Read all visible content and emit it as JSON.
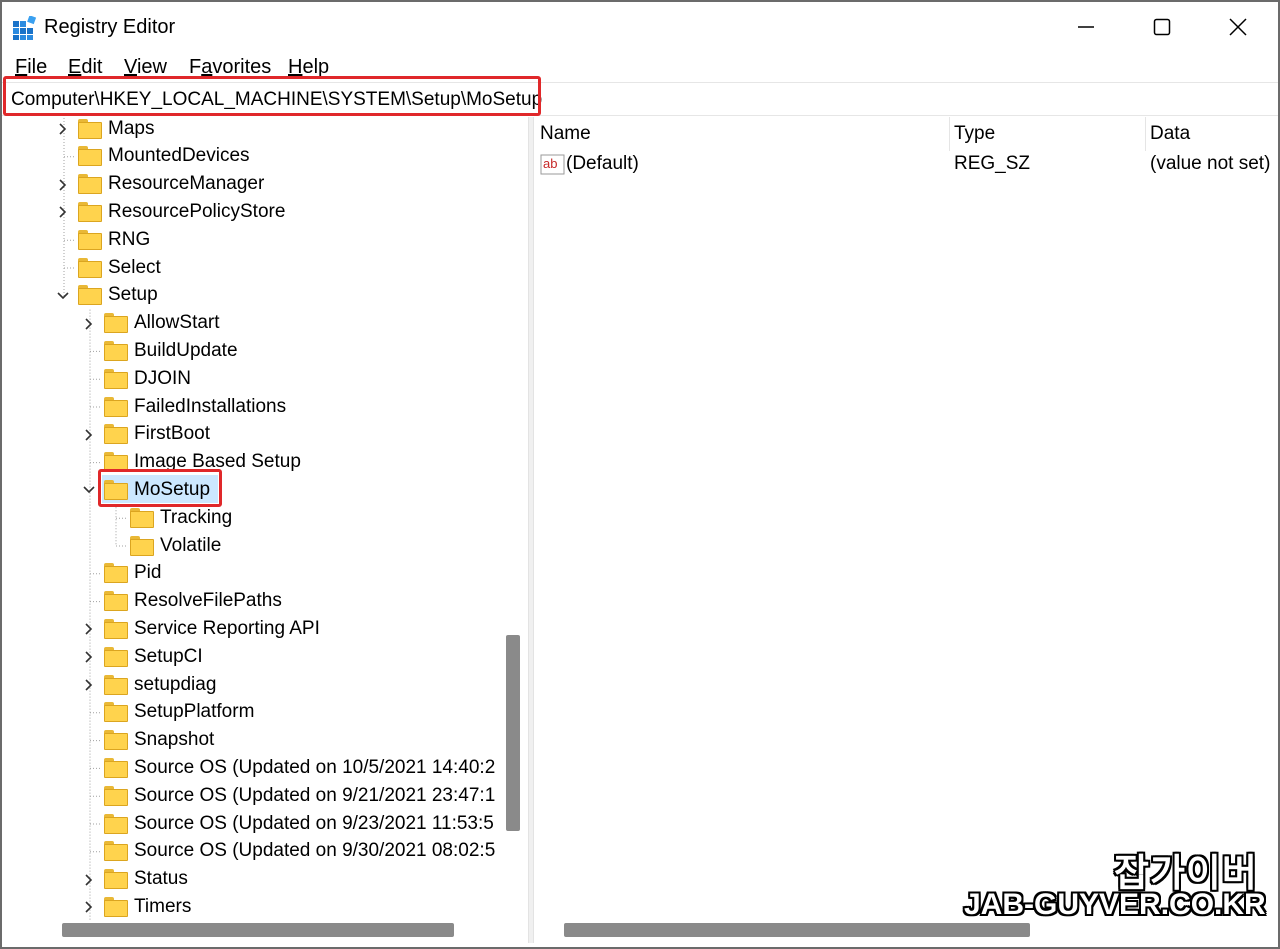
{
  "window": {
    "title": "Registry Editor",
    "icon": "registry-icon",
    "controls": {
      "minimize": "minimize-icon",
      "maximize": "maximize-icon",
      "close": "close-icon"
    }
  },
  "menu": {
    "items": [
      {
        "label": "File",
        "accel": "F",
        "rest": "ile"
      },
      {
        "label": "Edit",
        "accel": "E",
        "rest": "dit"
      },
      {
        "label": "View",
        "accel": "V",
        "rest": "iew"
      },
      {
        "label": "Favorites",
        "accel": "a",
        "pre": "F",
        "rest": "vorites"
      },
      {
        "label": "Help",
        "accel": "H",
        "rest": "elp"
      }
    ]
  },
  "address": {
    "path": "Computer\\HKEY_LOCAL_MACHINE\\SYSTEM\\Setup\\MoSetup"
  },
  "tree": {
    "items": [
      {
        "label": "Maps",
        "expander": "collapsed",
        "level": 0
      },
      {
        "label": "MountedDevices",
        "expander": "none",
        "level": 0
      },
      {
        "label": "ResourceManager",
        "expander": "collapsed",
        "level": 0
      },
      {
        "label": "ResourcePolicyStore",
        "expander": "collapsed",
        "level": 0
      },
      {
        "label": "RNG",
        "expander": "none",
        "level": 0
      },
      {
        "label": "Select",
        "expander": "none",
        "level": 0
      },
      {
        "label": "Setup",
        "expander": "expanded",
        "level": 0
      },
      {
        "label": "AllowStart",
        "expander": "collapsed",
        "level": 1
      },
      {
        "label": "BuildUpdate",
        "expander": "none",
        "level": 1
      },
      {
        "label": "DJOIN",
        "expander": "none",
        "level": 1
      },
      {
        "label": "FailedInstallations",
        "expander": "none",
        "level": 1
      },
      {
        "label": "FirstBoot",
        "expander": "collapsed",
        "level": 1
      },
      {
        "label": "Image Based Setup",
        "expander": "none",
        "level": 1
      },
      {
        "label": "MoSetup",
        "expander": "expanded",
        "level": 1,
        "selected": true
      },
      {
        "label": "Tracking",
        "expander": "none",
        "level": 2
      },
      {
        "label": "Volatile",
        "expander": "none",
        "level": 2
      },
      {
        "label": "Pid",
        "expander": "none",
        "level": 1
      },
      {
        "label": "ResolveFilePaths",
        "expander": "none",
        "level": 1
      },
      {
        "label": "Service Reporting API",
        "expander": "collapsed",
        "level": 1
      },
      {
        "label": "SetupCI",
        "expander": "collapsed",
        "level": 1
      },
      {
        "label": "setupdiag",
        "expander": "collapsed",
        "level": 1
      },
      {
        "label": "SetupPlatform",
        "expander": "none",
        "level": 1
      },
      {
        "label": "Snapshot",
        "expander": "none",
        "level": 1
      },
      {
        "label": "Source OS (Updated on 10/5/2021 14:40:2",
        "expander": "none",
        "level": 1
      },
      {
        "label": "Source OS (Updated on 9/21/2021 23:47:1",
        "expander": "none",
        "level": 1
      },
      {
        "label": "Source OS (Updated on 9/23/2021 11:53:5",
        "expander": "none",
        "level": 1
      },
      {
        "label": "Source OS (Updated on 9/30/2021 08:02:5",
        "expander": "none",
        "level": 1
      },
      {
        "label": "Status",
        "expander": "collapsed",
        "level": 1
      },
      {
        "label": "Timers",
        "expander": "collapsed",
        "level": 1
      }
    ]
  },
  "values": {
    "columns": {
      "name": "Name",
      "type": "Type",
      "data": "Data"
    },
    "rows": [
      {
        "name": "(Default)",
        "type": "REG_SZ",
        "data": "(value not set)",
        "icon": "string-value-icon"
      }
    ]
  },
  "watermark": {
    "korean": "잡가이버",
    "url": "JAB-GUYVER.CO.KR"
  },
  "colors": {
    "highlight": "#e0282a",
    "selection": "#cce8ff",
    "folder": "#ffd34d"
  }
}
